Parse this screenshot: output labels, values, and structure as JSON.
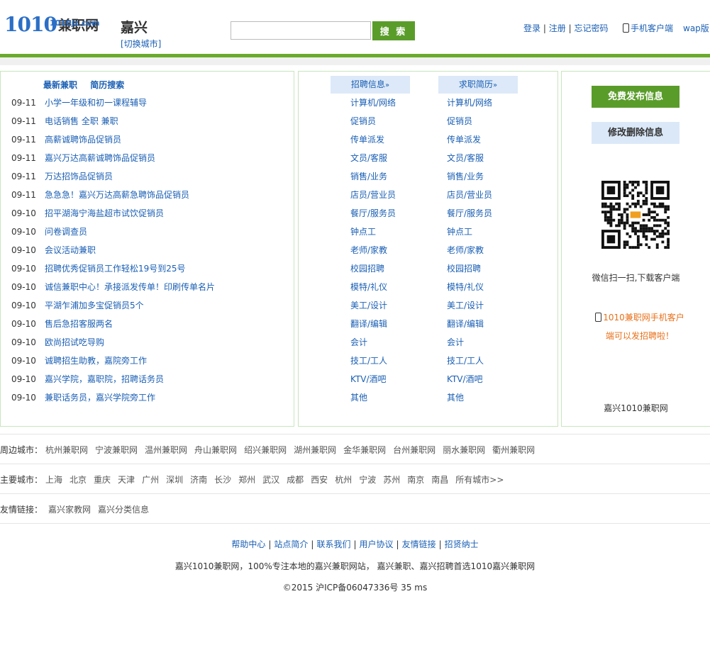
{
  "header": {
    "logo_number": "1010",
    "logo_cn": "兼职网",
    "logo_domain": "1010jz.com",
    "city": "嘉兴",
    "switch_city": "[切换城市]",
    "search_placeholder": "",
    "search_button": "搜 索",
    "login": "登录",
    "register": "注册",
    "forgot": "忘记密码",
    "mobile_client": "手机客户端",
    "wap": "wap版",
    "sep": "|"
  },
  "left_panel": {
    "tabs": [
      "最新兼职",
      "简历搜索"
    ],
    "jobs": [
      {
        "date": "09-11",
        "title": "小学一年级和初一课程辅导"
      },
      {
        "date": "09-11",
        "title": "电话销售 全职 兼职"
      },
      {
        "date": "09-11",
        "title": "高薪诚聘饰品促销员"
      },
      {
        "date": "09-11",
        "title": "嘉兴万达高薪诚聘饰品促销员"
      },
      {
        "date": "09-11",
        "title": "万达招饰品促销员"
      },
      {
        "date": "09-11",
        "title": "急急急！嘉兴万达高薪急聘饰品促销员"
      },
      {
        "date": "09-10",
        "title": "招平湖海宁海盐超市试饮促销员"
      },
      {
        "date": "09-10",
        "title": "问卷调查员"
      },
      {
        "date": "09-10",
        "title": "会议活动兼职"
      },
      {
        "date": "09-10",
        "title": "招聘优秀促销员工作轻松19号到25号"
      },
      {
        "date": "09-10",
        "title": "诚信兼职中心！承接派发传单！印刷传单名片"
      },
      {
        "date": "09-10",
        "title": "平湖乍浦加多宝促销员5个"
      },
      {
        "date": "09-10",
        "title": "售后急招客服两名"
      },
      {
        "date": "09-10",
        "title": "欧尚招试吃导购"
      },
      {
        "date": "09-10",
        "title": "诚聘招生助教，嘉院旁工作"
      },
      {
        "date": "09-10",
        "title": "嘉兴学院，嘉职院，招聘话务员"
      },
      {
        "date": "09-10",
        "title": "兼职话务员，嘉兴学院旁工作"
      }
    ]
  },
  "mid_panel": {
    "recruit_head": "招聘信息",
    "resume_head": "求职简历",
    "arrow": "»",
    "categories": [
      "计算机/网络",
      "促销员",
      "传单派发",
      "文员/客服",
      "销售/业务",
      "店员/营业员",
      "餐厅/服务员",
      "钟点工",
      "老师/家教",
      "校园招聘",
      "模特/礼仪",
      "美工/设计",
      "翻译/编辑",
      "会计",
      "技工/工人",
      "KTV/酒吧",
      "其他"
    ]
  },
  "right_panel": {
    "publish_btn": "免费发布信息",
    "edit_btn": "修改删除信息",
    "qr_caption": "微信扫一扫,下载客户端",
    "promo_line1": "1010兼职网手机客户",
    "promo_line2": "端可以发招聘啦！",
    "site_name": "嘉兴1010兼职网"
  },
  "nearby": {
    "label": "周边城市：",
    "items": [
      "杭州兼职网",
      "宁波兼职网",
      "温州兼职网",
      "舟山兼职网",
      "绍兴兼职网",
      "湖州兼职网",
      "金华兼职网",
      "台州兼职网",
      "丽水兼职网",
      "衢州兼职网"
    ]
  },
  "major": {
    "label": "主要城市：",
    "items": [
      "上海",
      "北京",
      "重庆",
      "天津",
      "广州",
      "深圳",
      "济南",
      "长沙",
      "郑州",
      "武汉",
      "成都",
      "西安",
      "杭州",
      "宁波",
      "苏州",
      "南京",
      "南昌",
      "所有城市>>"
    ]
  },
  "friends": {
    "label": "友情链接：",
    "items": [
      "嘉兴家教网",
      "嘉兴分类信息"
    ]
  },
  "footer": {
    "links": [
      "帮助中心",
      "站点简介",
      "联系我们",
      "用户协议",
      "友情链接",
      "招贤纳士"
    ],
    "desc": "嘉兴1010兼职网，100%专注本地的嘉兴兼职网站， 嘉兴兼职、嘉兴招聘首选1010嘉兴兼职网",
    "copyright": "©2015 沪ICP备06047336号    35 ms"
  },
  "colors": {
    "brand_green": "#5a9c2a",
    "link_blue": "#1a5fb4",
    "promo_orange": "#e8701a"
  }
}
